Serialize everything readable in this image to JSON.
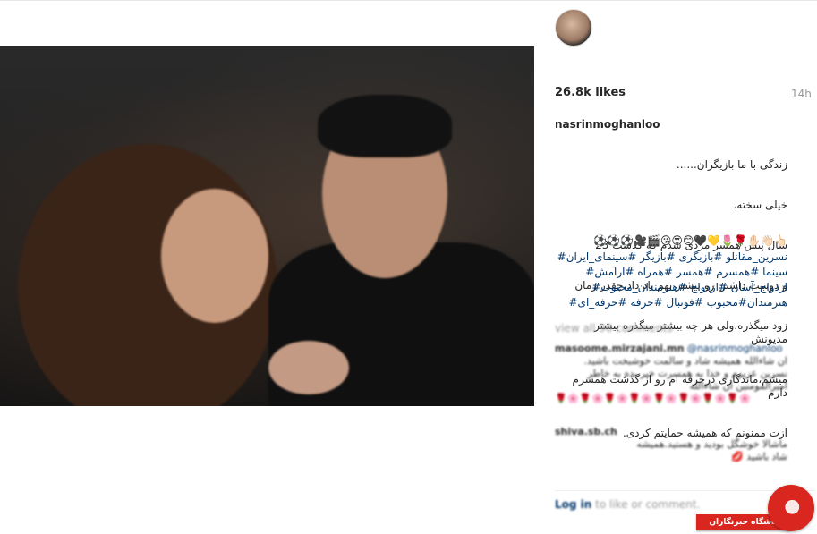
{
  "post": {
    "likes": "26.8k likes",
    "time": "14h",
    "username": "nasrinmoghanloo",
    "caption_lines": [
      "زندگی با ما بازیگران......",
      "خیلی سخته.",
      "سال پیش همسر مردی شدم که گذشت 23",
      "و دوست داشتن رو بیشتر بهم یاد داد،چقدر زمان",
      "زود میگذره،ولی هر چه بیشتر میگذره بیشتر مدیونش",
      "میشم،ماندگاری درحرفه ام رو از گذشت همسرم دارم",
      "ازت ممنونم که همیشه حمایتم کردی."
    ],
    "emoji_line": "👆🏻👋🏻✋🏻🌹🌷💛🖤😊😍😘🎬🎥⚽⚽⚽",
    "hashtag_lines": [
      "نسرین_مقانلو #بازیگری #بازیگر #سینمای_ایران#",
      "سینما #همسرم #همسر #همراه #ارامش#",
      "ازدواج_آسان #ازدواج #هنرمندان_محبوب#",
      "هنرمندان#محبوب #فوتبال #حرفه #حرفه_ای#"
    ]
  },
  "comments": {
    "view_all": "view all 96 comments",
    "items": [
      {
        "user": "masoome.mirzajani.mn",
        "mention": "@nasrinmoghanloo",
        "lines": [
          "ان شاءالله همیشه شاد و سالمت خوشبخت باشید.",
          "نسرین عزیزم و خدا به همسرت خیر بده به خاطر",
          "امیرالمومنین ان شاءالله"
        ],
        "emoji": "🌹🌸🌹🌸🌹🌸🌹🌸🌹🌸🌹🌸🌹🌸🌹🌸"
      },
      {
        "user": "shiva.sb.ch",
        "mention": "",
        "lines": [
          "ماشالا خوشگل بودید و هستید.همیشه",
          "شاد باشید 💋"
        ],
        "emoji": ""
      }
    ]
  },
  "footer": {
    "login_link": "Log in",
    "login_rest": " to like or comment.",
    "more": "..."
  },
  "badge": {
    "text": "باشگاه خبرنگاران"
  }
}
